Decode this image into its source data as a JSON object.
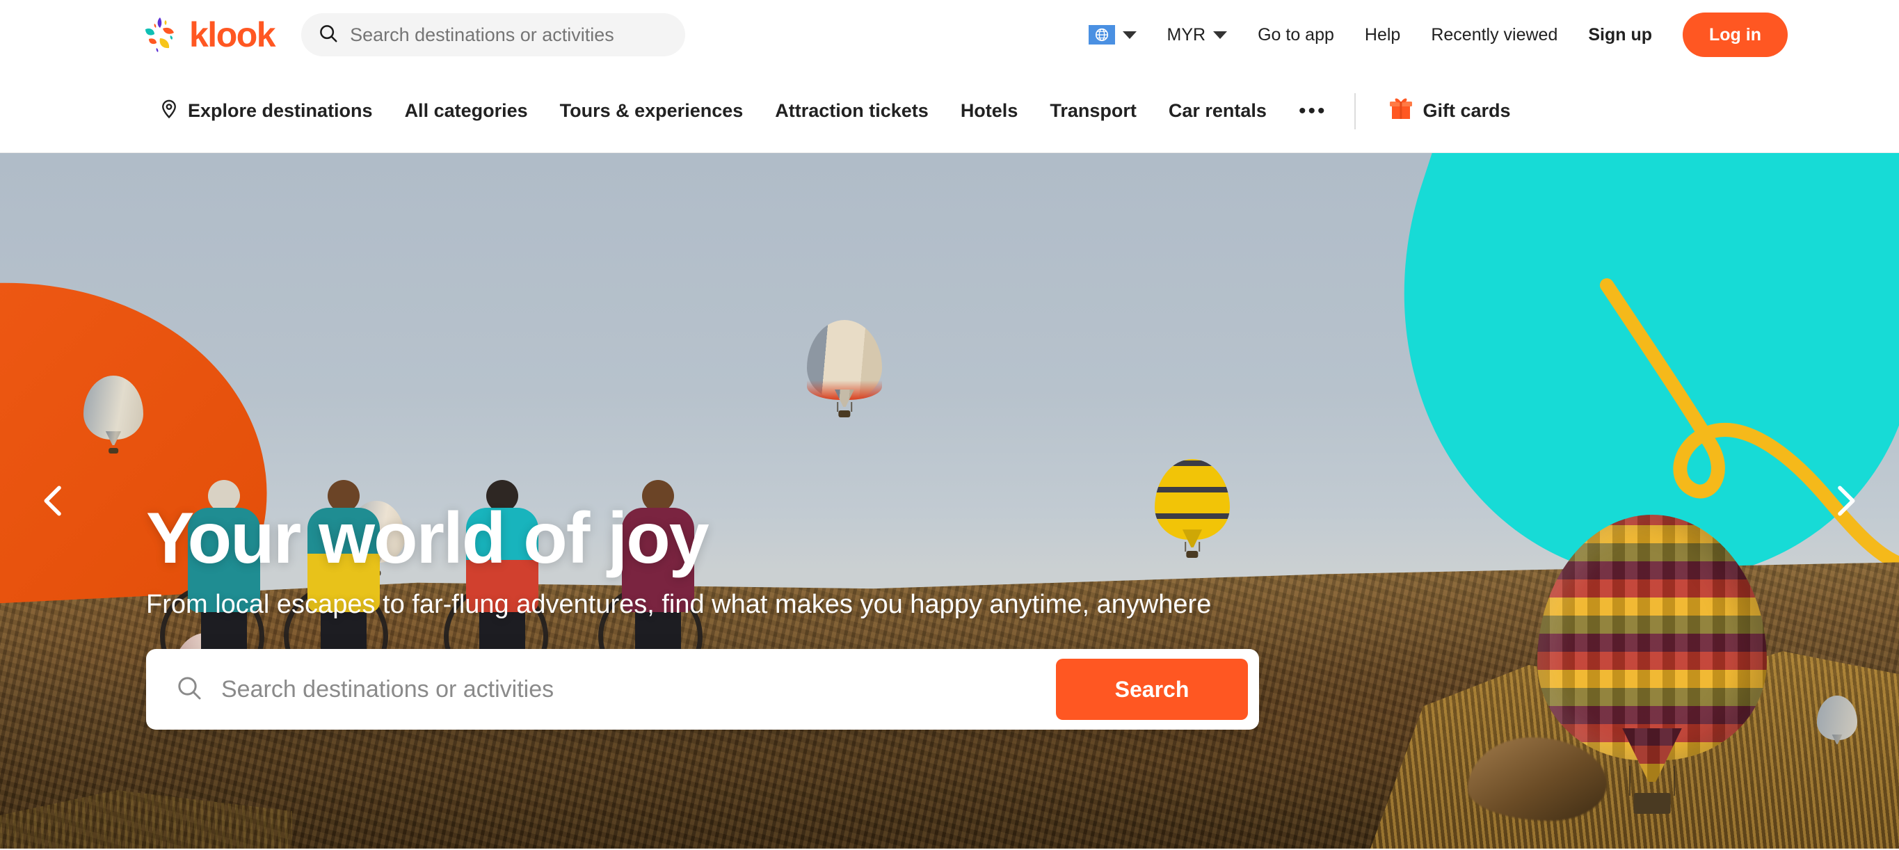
{
  "brand": {
    "name": "klook",
    "accent_color": "#ff5722",
    "logo_colors": [
      "#5b2fd4",
      "#ff5722",
      "#0fbfb4",
      "#f7c51a"
    ]
  },
  "header": {
    "search": {
      "placeholder": "Search destinations or activities",
      "value": ""
    },
    "language": {
      "icon": "globe-icon",
      "chip_color": "#4a90e2"
    },
    "currency": {
      "label": "MYR"
    },
    "links": [
      {
        "label": "Go to app"
      },
      {
        "label": "Help"
      },
      {
        "label": "Recently viewed"
      },
      {
        "label": "Sign up"
      }
    ],
    "login_button": "Log in"
  },
  "sub_nav": {
    "explore": {
      "icon": "location-pin-icon",
      "label": "Explore destinations"
    },
    "items": [
      {
        "label": "All categories"
      },
      {
        "label": "Tours & experiences"
      },
      {
        "label": "Attraction tickets"
      },
      {
        "label": "Hotels"
      },
      {
        "label": "Transport"
      },
      {
        "label": "Car rentals"
      }
    ],
    "more": "•••",
    "gift_cards": {
      "icon": "gift-box-icon",
      "label": "Gift cards"
    }
  },
  "hero": {
    "title": "Your world of joy",
    "subtitle": "From local escapes to far-flung adventures, find what makes you happy anytime, anywhere",
    "search": {
      "placeholder": "Search destinations or activities",
      "value": "",
      "button": "Search"
    },
    "carousel": {
      "prev_icon": "chevron-left-icon",
      "next_icon": "chevron-right-icon"
    },
    "scene": {
      "description": "Hot air balloons over a rocky hillside at sunrise with cyclists",
      "shape_colors": {
        "orange_blob": "#f05a16",
        "cyan_blob": "#17dbd6",
        "yellow_squiggle": "#f5b91a"
      }
    }
  }
}
